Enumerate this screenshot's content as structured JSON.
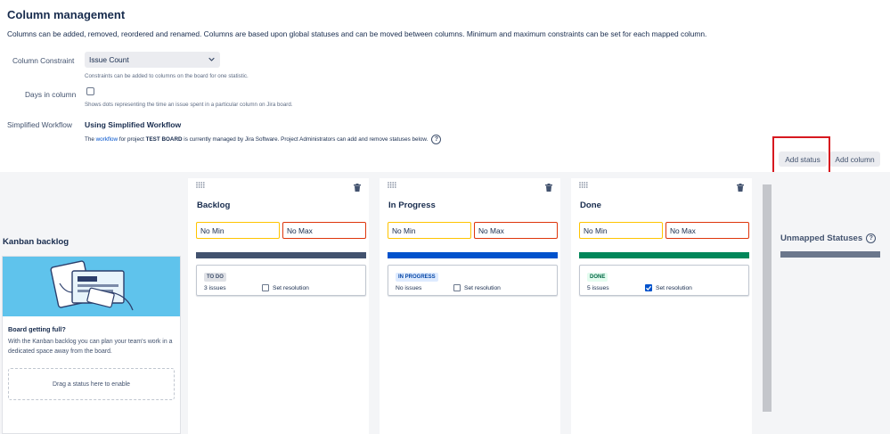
{
  "header": {
    "title": "Column management",
    "description": "Columns can be added, removed, reordered and renamed. Columns are based upon global statuses and can be moved between columns. Minimum and maximum constraints can be set for each mapped column."
  },
  "settings": {
    "constraint": {
      "label": "Column Constraint",
      "value": "Issue Count",
      "help": "Constraints can be added to columns on the board for one statistic."
    },
    "days_in_column": {
      "label": "Days in column",
      "checked": false,
      "help": "Shows dots representing the time an issue spent in a particular column on Jira board."
    },
    "workflow": {
      "label": "Simplified Workflow",
      "title": "Using Simplified Workflow",
      "desc_part1": "The ",
      "desc_link": "workflow",
      "desc_part2": " for project ",
      "desc_project": "TEST BOARD",
      "desc_part3": " is currently managed by Jira Software. Project Administrators can add and remove statuses below.",
      "help_glyph": "?"
    }
  },
  "actions": {
    "add_status": "Add status",
    "add_column": "Add column"
  },
  "backlog": {
    "title": "Kanban backlog",
    "heading": "Board getting full?",
    "text": "With the Kanban backlog you can plan your team's work in a dedicated space away from the board.",
    "drop_text": "Drag a status here to enable"
  },
  "columns": [
    {
      "name": "Backlog",
      "min": "No Min",
      "max": "No Max",
      "bar_color": "#42526e",
      "status": "TO DO",
      "lozenge_bg": "#dfe1e6",
      "lozenge_fg": "#42526e",
      "count": "3 issues",
      "set_resolution": "Set resolution",
      "resolution_checked": false
    },
    {
      "name": "In Progress",
      "min": "No Min",
      "max": "No Max",
      "bar_color": "#0052cc",
      "status": "IN PROGRESS",
      "lozenge_bg": "#deebff",
      "lozenge_fg": "#0747a6",
      "count": "No issues",
      "set_resolution": "Set resolution",
      "resolution_checked": false
    },
    {
      "name": "Done",
      "min": "No Min",
      "max": "No Max",
      "bar_color": "#00875a",
      "status": "DONE",
      "lozenge_bg": "#e3fcef",
      "lozenge_fg": "#006644",
      "count": "5 issues",
      "set_resolution": "Set resolution",
      "resolution_checked": true
    }
  ],
  "unmapped": {
    "title": "Unmapped Statuses",
    "help_glyph": "?"
  },
  "icons": {
    "select": "chevron-down-icon",
    "grip": "drag-handle-icon",
    "trash": "trash-icon",
    "help": "question-circle-icon"
  }
}
